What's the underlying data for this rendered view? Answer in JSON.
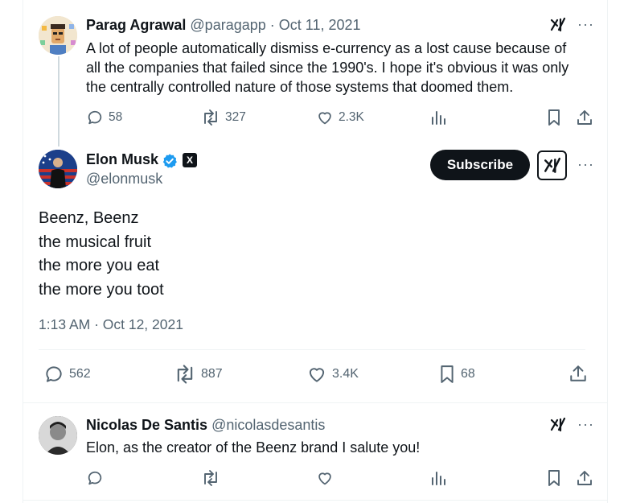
{
  "tweet1": {
    "name": "Parag Agrawal",
    "handle": "@paragapp",
    "date": "· Oct 11, 2021",
    "text_lines": [
      "A lot of people automatically dismiss e-currency as a lost cause because of",
      "all the companies that failed since the 1990's. I hope it's obvious it was only",
      "the centrally controlled nature of those systems that doomed them."
    ],
    "replies": "58",
    "reposts": "327",
    "likes": "2.3K"
  },
  "main_tweet": {
    "name": "Elon Musk",
    "handle": "@elonmusk",
    "subscribe_label": "Subscribe",
    "text_lines": [
      "Beenz, Beenz",
      "the musical fruit",
      "the more you eat",
      "the more you toot"
    ],
    "timestamp": "1:13 AM · Oct 12, 2021",
    "replies": "562",
    "reposts": "887",
    "likes": "3.4K",
    "bookmarks": "68"
  },
  "reply": {
    "name": "Nicolas De Santis",
    "handle": "@nicolasdesantis",
    "text": "Elon, as the creator of the Beenz brand I salute you!"
  },
  "icons": {
    "more": "more-icon",
    "grok": "grok-icon",
    "reply": "reply-icon",
    "repost": "repost-icon",
    "like": "like-icon",
    "views": "views-icon",
    "bookmark": "bookmark-icon",
    "share": "share-icon",
    "verified": "verified-badge-icon"
  },
  "colors": {
    "verified_blue": "#1d9bf0",
    "muted": "#536471",
    "text": "#0f1419"
  }
}
